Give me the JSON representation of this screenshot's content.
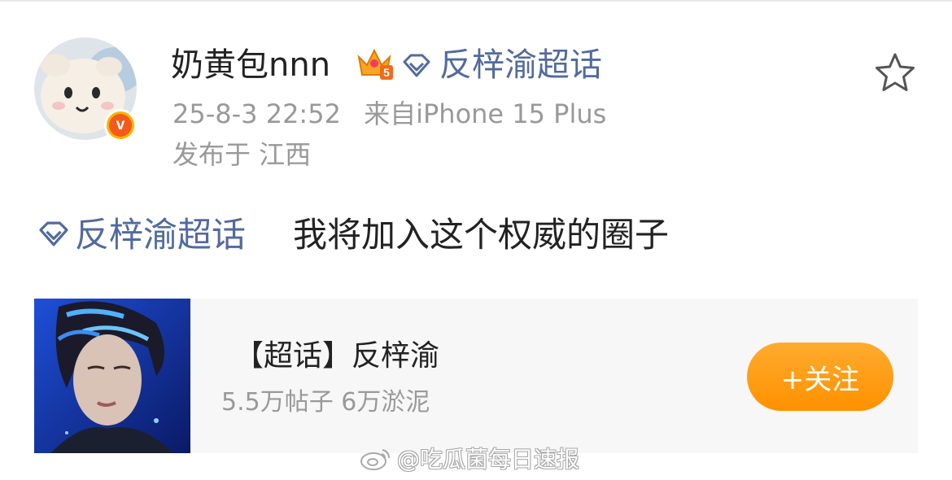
{
  "colors": {
    "link": "#526a9e",
    "follow_button": "#ff9c1a",
    "muted": "#999999"
  },
  "post": {
    "author": {
      "name": "奶黄包nnn",
      "badge_icon": "crown-level-5-icon",
      "verified_icon": "verified-v-icon"
    },
    "topic": "反梓渝超话",
    "timestamp": "25-8-3 22:52",
    "source": "来自iPhone 15 Plus",
    "location": "发布于 江西",
    "body_topic": "反梓渝超话",
    "body_text": "我将加入这个权威的圈子"
  },
  "card": {
    "title": "【超话】反梓渝",
    "stats": "5.5万帖子 6万淤泥",
    "follow_label": "+关注"
  },
  "watermark": {
    "text": "@吃瓜菌每日速报"
  }
}
